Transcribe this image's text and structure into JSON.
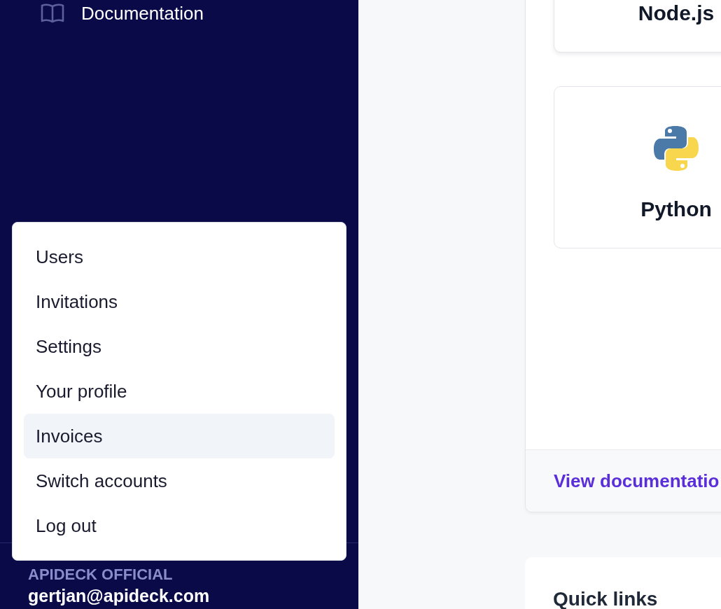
{
  "sidebar": {
    "nav_items": [
      {
        "label": "Documentation"
      }
    ]
  },
  "account_menu": {
    "items": [
      {
        "label": "Users",
        "selected": false
      },
      {
        "label": "Invitations",
        "selected": false
      },
      {
        "label": "Settings",
        "selected": false
      },
      {
        "label": "Your profile",
        "selected": false
      },
      {
        "label": "Invoices",
        "selected": true
      },
      {
        "label": "Switch accounts",
        "selected": false
      },
      {
        "label": "Log out",
        "selected": false
      }
    ]
  },
  "account": {
    "organization": "APIDECK OFFICIAL",
    "email": "gertjan@apideck.com"
  },
  "sdk_panel": {
    "languages": [
      {
        "name": "Node.js",
        "kind": "plain"
      },
      {
        "name": "Python",
        "kind": "python"
      }
    ],
    "link": "View documentatio"
  },
  "quick_links": {
    "title": "Quick links"
  }
}
